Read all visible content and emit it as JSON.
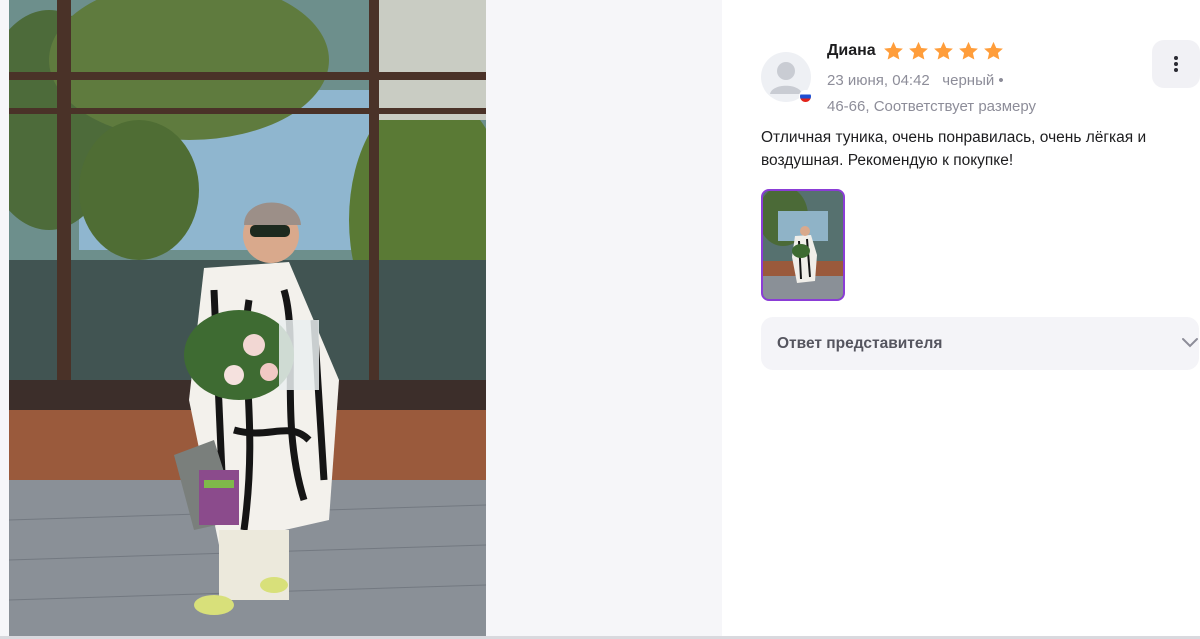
{
  "review": {
    "author": "Диана",
    "rating": 5,
    "rating_max": 5,
    "date": "23 июня, 04:42",
    "color": "черный •",
    "size": "46-66, Соответствует размеру",
    "text": "Отличная туника, очень понравилась, очень лёгкая и воздушная. Рекомендую к покупке!",
    "reply_label": "Ответ представителя"
  },
  "colors": {
    "star": "#ff9d3a",
    "thumb_border": "#8b3dd6",
    "meta_text": "#8d8d99"
  },
  "icons": {
    "more": "kebab-vertical-icon",
    "reply": "chevron-down-icon",
    "avatar": "user-placeholder-icon",
    "flag": "russia-flag-icon"
  }
}
